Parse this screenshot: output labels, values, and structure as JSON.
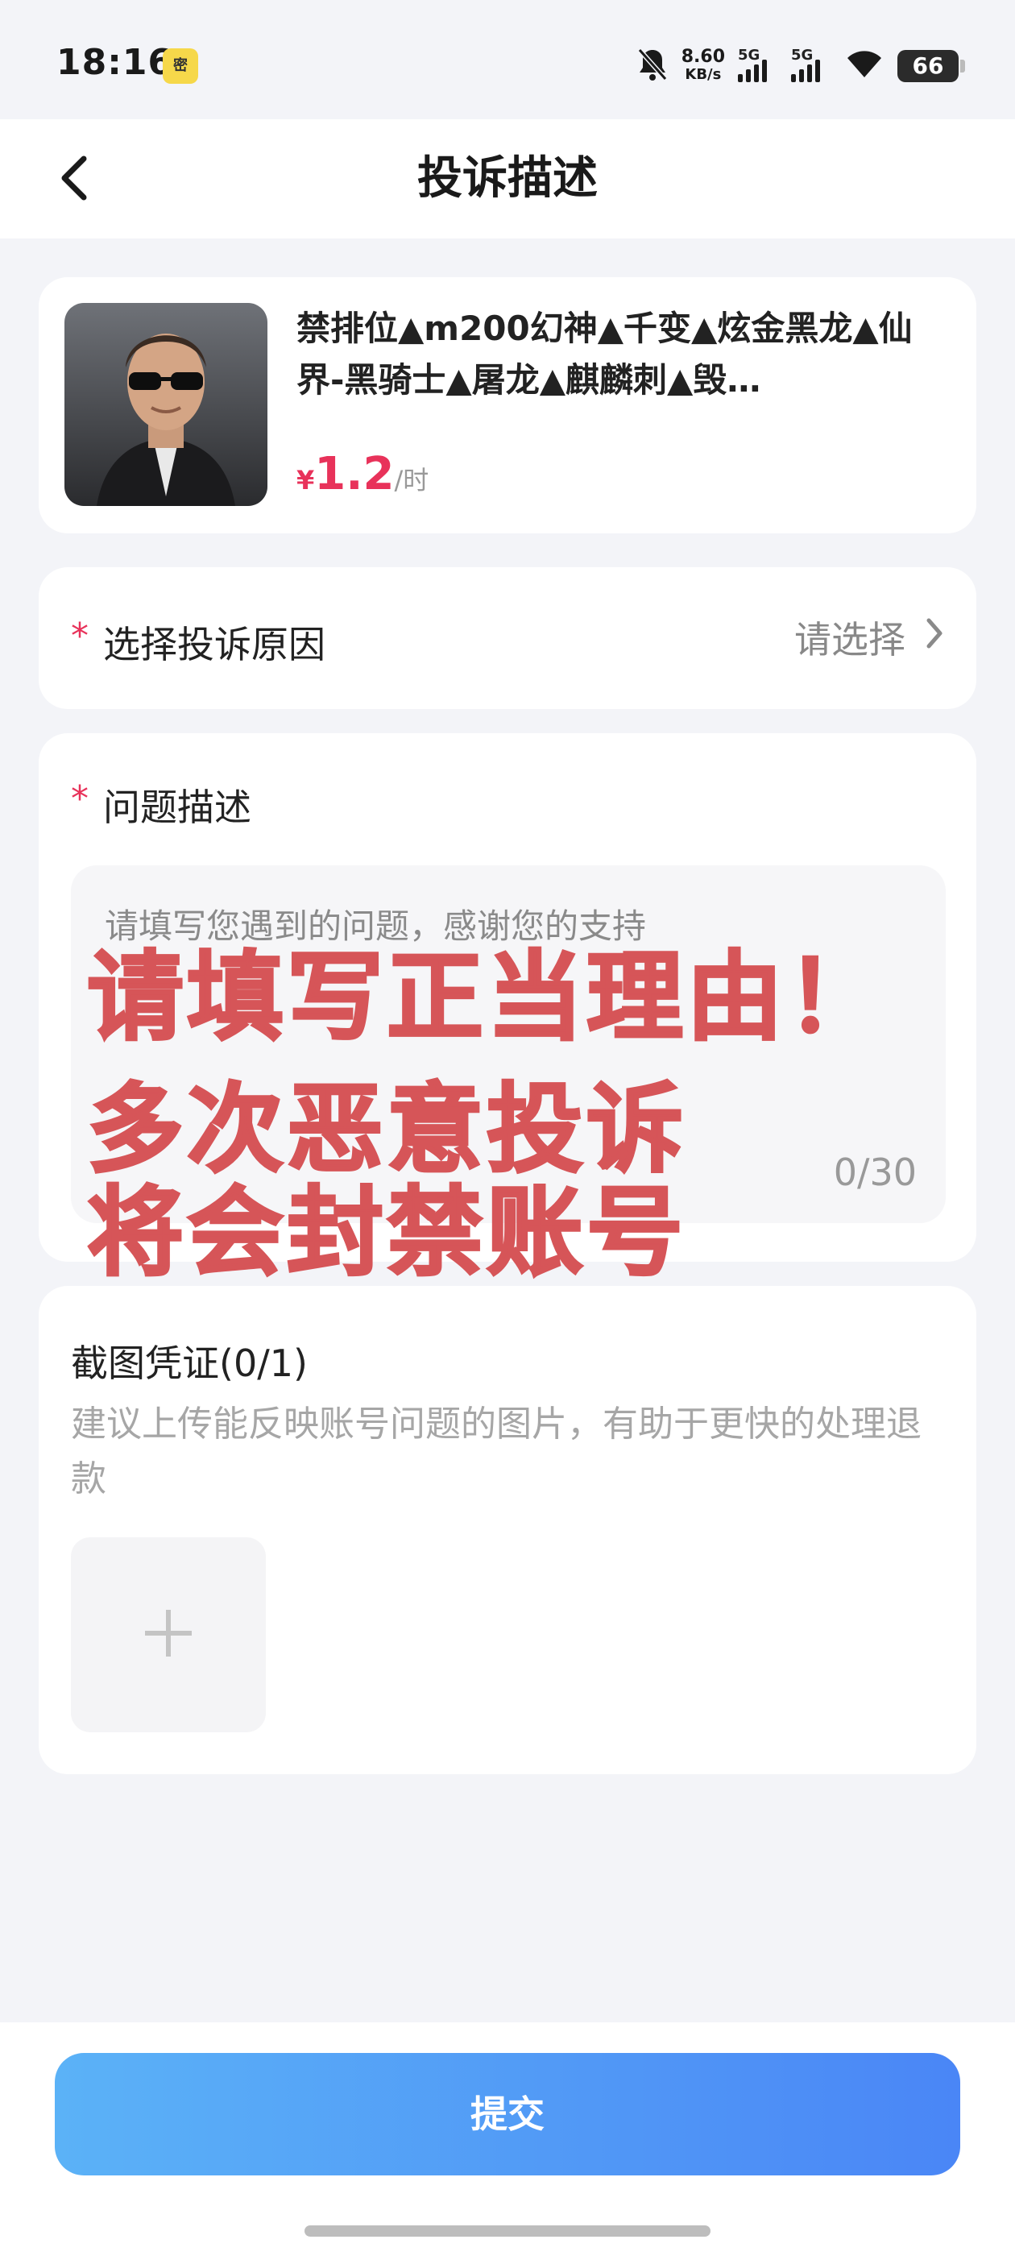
{
  "status_bar": {
    "time": "18:16",
    "app_icon_text": "密",
    "net_speed_value": "8.60",
    "net_speed_unit": "KB/s",
    "signal_1_label": "5G",
    "signal_2_label": "5G",
    "battery": "66"
  },
  "header": {
    "title": "投诉描述",
    "back_icon": "chevron-left-icon"
  },
  "product": {
    "title": "禁排位▲m200幻神▲千变▲炫金黑龙▲仙界-黑骑士▲屠龙▲麒麟刺▲毁…",
    "price_currency": "¥",
    "price_value": "1.2",
    "price_unit": "/时"
  },
  "reason": {
    "required_mark": "*",
    "label": "选择投诉原因",
    "placeholder": "请选择"
  },
  "description": {
    "required_mark": "*",
    "label": "问题描述",
    "placeholder": "请填写您遇到的问题，感谢您的支持",
    "counter": "0/30"
  },
  "warning_overlay": {
    "line1": "请填写正当理由！",
    "line2": "多次恶意投诉",
    "line3": "将会封禁账号",
    "color": "#d65558"
  },
  "screenshots": {
    "label": "截图凭证(0/1)",
    "hint": "建议上传能反映账号问题的图片，有助于更快的处理退款",
    "upload_icon": "plus-icon"
  },
  "footer": {
    "submit_label": "提交"
  },
  "colors": {
    "accent_red": "#e8325a",
    "button_gradient_start": "#5bb2f7",
    "button_gradient_end": "#4a86f6",
    "background": "#f3f4f8"
  }
}
